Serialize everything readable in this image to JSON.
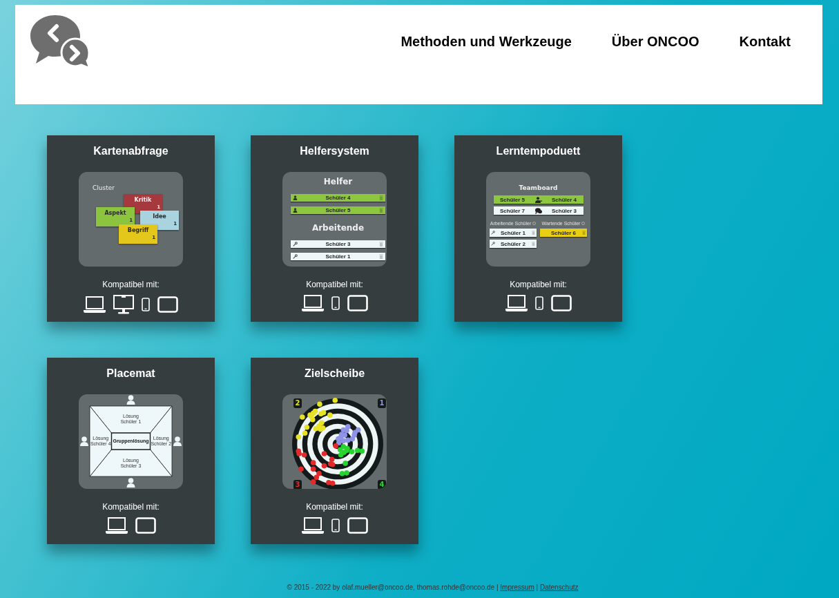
{
  "header": {
    "nav": [
      {
        "label": "Methoden und Werkzeuge"
      },
      {
        "label": "Über ONCOO"
      },
      {
        "label": "Kontakt"
      }
    ]
  },
  "cards": [
    {
      "title": "Kartenabfrage",
      "preview": {
        "kind": "cluster",
        "heading": "Cluster",
        "notes": [
          {
            "label": "Kritik",
            "count": "1",
            "color": "#a5393e"
          },
          {
            "label": "Aspekt",
            "count": "1",
            "color": "#8cc43f"
          },
          {
            "label": "Idee",
            "count": "1",
            "color": "#a9d3df"
          },
          {
            "label": "Begriff",
            "count": "1",
            "color": "#e3c81b"
          }
        ]
      },
      "compat_label": "Kompatibel mit:",
      "devices": [
        {
          "kind": "laptop"
        },
        {
          "kind": "desktop"
        },
        {
          "kind": "phone"
        },
        {
          "kind": "tablet"
        }
      ]
    },
    {
      "title": "Helfersystem",
      "preview": {
        "kind": "helpers",
        "sections": [
          {
            "heading": "Helfer",
            "kind": "helper",
            "rows": [
              {
                "label": "Schüler 4"
              },
              {
                "label": "Schüler 5"
              }
            ]
          },
          {
            "heading": "Arbeitende",
            "kind": "worker",
            "rows": [
              {
                "label": "Schüler 3"
              },
              {
                "label": "Schüler 1"
              }
            ]
          }
        ]
      },
      "compat_label": "Kompatibel mit:",
      "devices": [
        {
          "kind": "laptop"
        },
        {
          "kind": "phone"
        },
        {
          "kind": "tablet"
        }
      ]
    },
    {
      "title": "Lerntempoduett",
      "preview": {
        "kind": "teamboard",
        "heading": "Teamboard",
        "pairs": [
          {
            "kind": "helping",
            "left": "Schüler 5",
            "right": "Schüler 4"
          },
          {
            "kind": "talking",
            "left": "Schüler 7",
            "right": "Schüler 3"
          }
        ],
        "columns": [
          {
            "heading": "Arbeitende Schüler",
            "kind": "working",
            "rows": [
              {
                "label": "Schüler 1"
              },
              {
                "label": "Schüler 2"
              }
            ]
          },
          {
            "heading": "Wartende Schüler",
            "kind": "waiting",
            "rows": [
              {
                "label": "Schüler 6"
              }
            ]
          }
        ]
      },
      "compat_label": "Kompatibel mit:",
      "devices": [
        {
          "kind": "laptop"
        },
        {
          "kind": "phone"
        },
        {
          "kind": "tablet"
        }
      ]
    },
    {
      "title": "Placemat",
      "preview": {
        "kind": "placemat",
        "center": "Gruppenlösung",
        "fields": [
          "Lösung Schüler 1",
          "Lösung Schüler 2",
          "Lösung Schüler 3",
          "Lösung Schüler 4"
        ]
      },
      "compat_label": "Kompatibel mit:",
      "devices": [
        {
          "kind": "laptop"
        },
        {
          "kind": "tablet"
        }
      ]
    },
    {
      "title": "Zielscheibe",
      "preview": {
        "kind": "target",
        "quadrants": [
          {
            "label": "2",
            "color": "#e6e226"
          },
          {
            "label": "1",
            "color": "#8e93e6"
          },
          {
            "label": "3",
            "color": "#e32a2a"
          },
          {
            "label": "4",
            "color": "#25d42d"
          }
        ]
      },
      "compat_label": "Kompatibel mit:",
      "devices": [
        {
          "kind": "laptop"
        },
        {
          "kind": "phone"
        },
        {
          "kind": "tablet"
        }
      ]
    }
  ],
  "footer": {
    "parts": [
      {
        "kind": "text",
        "text": "© 2015 - 2022 by olaf.mueller@oncoo.de, thomas.rohde@oncoo.de |"
      },
      {
        "kind": "link",
        "text": "Impressum"
      },
      {
        "kind": "text",
        "text": "|"
      },
      {
        "kind": "link",
        "text": "Datenschutz"
      }
    ]
  }
}
